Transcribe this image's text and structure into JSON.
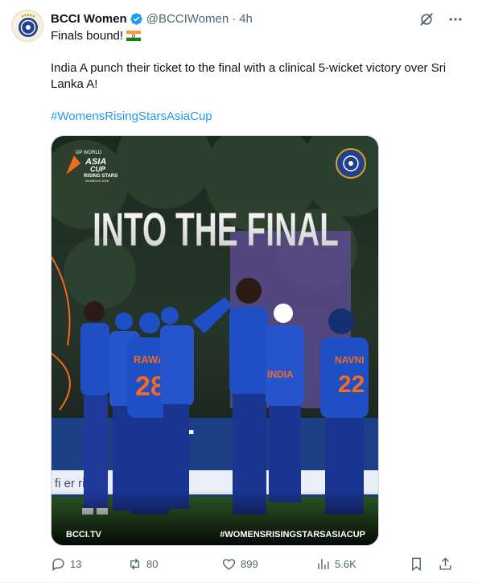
{
  "author": {
    "name": "BCCI Women",
    "handle": "@BCCIWomen",
    "separator": "·",
    "time": "4h",
    "avatar_icon": "bcci-logo-icon",
    "verified_icon": "verified-badge-icon"
  },
  "tweet": {
    "line1": "Finals bound!",
    "line1_emoji": "india-flag-icon",
    "line2": "India A punch their ticket to the final with a clinical 5-wicket victory over Sri Lanka A!",
    "hashtag": "#WomensRisingStarsAsiaCup"
  },
  "media": {
    "headline": "INTO THE FINAL",
    "sponsor": "DP WORLD",
    "event_line1": "ASIA",
    "event_line2": "CUP",
    "event_line3": "RISING STARS",
    "event_line4": "WOMEN'S 2025",
    "footer_left": "BCCI.TV",
    "footer_right": "#WOMENSRISINGSTARSASIACUP",
    "jersey_name_left": "RAWAT",
    "jersey_number_left": "28",
    "jersey_name_right": "NAVNI",
    "jersey_number_right": "22",
    "chest_text": "INDIA",
    "board_text": "T",
    "banner_text": "fi        er   rifie"
  },
  "stats": {
    "replies": "13",
    "reposts": "80",
    "likes": "899",
    "views": "5.6K"
  },
  "colors": {
    "accent": "#1d9bf0",
    "secondary_text": "#536471",
    "jersey_blue": "#1f4fc4",
    "jersey_orange": "#f26a21"
  }
}
